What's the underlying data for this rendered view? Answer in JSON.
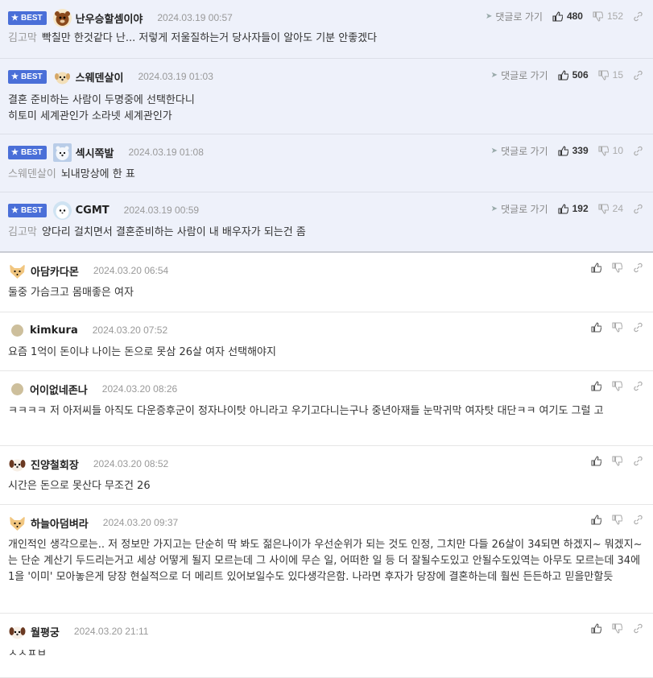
{
  "labels": {
    "best": "BEST",
    "reply": "댓글로 가기"
  },
  "colors": {
    "best_bg": "#eef1fa",
    "badge": "#4a6fd8",
    "border": "#e6e6e6"
  },
  "best_comments": [
    {
      "nick": "난우승할셈이야",
      "date": "2024.03.19 00:57",
      "up": "480",
      "down": "152",
      "mention": "김고막",
      "text": "빡칠만 한것같다 난... 저렇게 저울질하는거 당사자들이 알아도 기분 안좋겠다",
      "avatar": "bear-icon"
    },
    {
      "nick": "스웨덴살이",
      "date": "2024.03.19 01:03",
      "up": "506",
      "down": "15",
      "mention": "",
      "text": "결혼 준비하는 사람이 두명중에 선택한다니\n히토미 세계관인가 소라넷 세계관인가",
      "avatar": "dog-icon"
    },
    {
      "nick": "섹시쪽발",
      "date": "2024.03.19 01:08",
      "up": "339",
      "down": "10",
      "mention": "스웨덴살이",
      "text": "뇌내망상에 한 표",
      "avatar": "polar-bear-icon"
    },
    {
      "nick": "CGMT",
      "date": "2024.03.19 00:59",
      "up": "192",
      "down": "24",
      "mention": "김고막",
      "text": "양다리 걸치면서 결혼준비하는 사람이 내 배우자가 되는건 좀",
      "avatar": "seal-icon"
    }
  ],
  "comments": [
    {
      "nick": "아담카다몬",
      "date": "2024.03.20 06:54",
      "text": "둘중 가슴크고 몸매좋은 여자",
      "avatar": "fox-icon"
    },
    {
      "nick": "kimkura",
      "date": "2024.03.20 07:52",
      "text": "요즘 1억이 돈이냐 나이는 돈으로 못삼 26살 여자 선택해야지",
      "avatar": "dot"
    },
    {
      "nick": "어이없네존나",
      "date": "2024.03.20 08:26",
      "text": "ㅋㅋㅋㅋ 저 아저씨들 아직도 다운증후군이 정자나이탓 아니라고 우기고다니는구나 중년아재들 눈막귀막 여자탓 대단ㅋㅋ 여기도 그럴 고",
      "avatar": "dot"
    },
    {
      "nick": "진양철회장",
      "date": "2024.03.20 08:52",
      "text": "시간은 돈으로 못산다 무조건 26",
      "avatar": "dog2-icon"
    },
    {
      "nick": "하늘아덤벼라",
      "date": "2024.03.20 09:37",
      "text": "개인적인 생각으로는.. 저 정보만 가지고는 단순히 딱 봐도 젊은나이가 우선순위가 되는 것도 인정, 그치만 다들 26살이 34되면 하겠지~ 뭐겠지~는 단순 계산기 두드리는거고 세상 어떻게 될지 모르는데 그 사이에 무슨 일, 어떠한 일 등 더 잘될수도있고 안될수도있역는 아무도 모르는데 34에 1을 '이미' 모아놓은게 당장 현실적으로 더 메리트 있어보일수도 있다생각은함. 나라면 후자가 당장에 결혼하는데 훨씬 든든하고 믿을만할듯",
      "avatar": "fox-icon"
    },
    {
      "nick": "월평궁",
      "date": "2024.03.20 21:11",
      "text": "ㅅㅅㅍㅂ",
      "avatar": "dog2-icon"
    }
  ]
}
